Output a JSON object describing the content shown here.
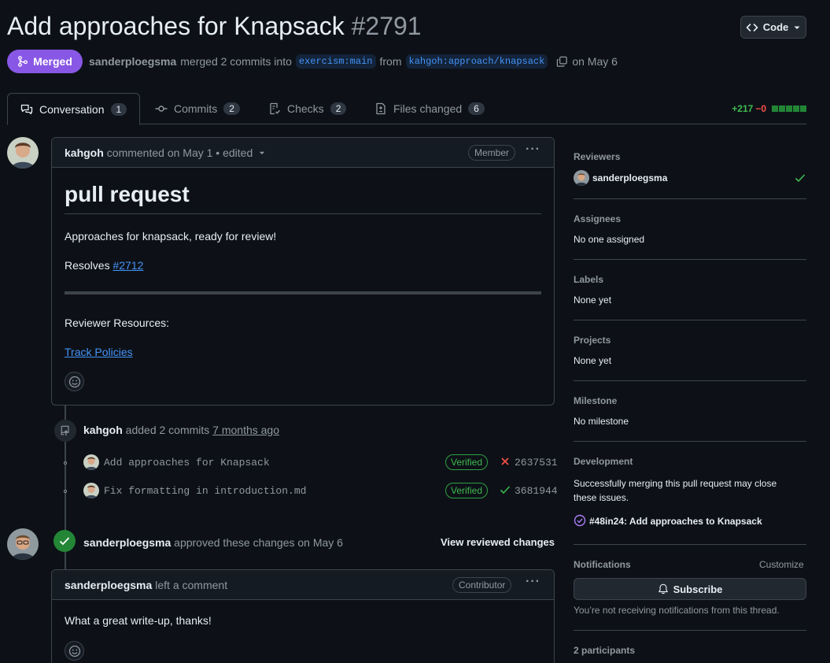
{
  "pr": {
    "title": "Add approaches for Knapsack",
    "number": "#2791",
    "state_label": "Merged",
    "author": "sanderploegsma",
    "merge_text": "merged 2 commits into",
    "base_branch": "exercism:main",
    "from_text": "from",
    "head_branch": "kahgoh:approach/knapsack",
    "date_text": "on May 6",
    "code_button": "Code"
  },
  "tabs": [
    {
      "label": "Conversation",
      "count": "1"
    },
    {
      "label": "Commits",
      "count": "2"
    },
    {
      "label": "Checks",
      "count": "2"
    },
    {
      "label": "Files changed",
      "count": "6"
    }
  ],
  "diffstat": {
    "additions": "+217",
    "deletions": "−0"
  },
  "first_comment": {
    "author": "kahgoh",
    "meta": "commented on May 1 • edited",
    "role": "Member",
    "heading": "pull request",
    "para1": "Approaches for knapsack, ready for review!",
    "resolves_label": "Resolves",
    "resolves_link": "#2712",
    "resources_label": "Reviewer Resources:",
    "resources_link": "Track Policies"
  },
  "commits_event": {
    "author": "kahgoh",
    "text": "added 2 commits",
    "time": "7 months ago"
  },
  "commits": [
    {
      "message": "Add approaches for Knapsack",
      "verified": "Verified",
      "status": "fail",
      "sha": "2637531"
    },
    {
      "message": "Fix formatting in introduction.md",
      "verified": "Verified",
      "status": "pass",
      "sha": "3681944"
    }
  ],
  "review_event": {
    "author": "sanderploegsma",
    "text": "approved these changes on May 6",
    "action": "View reviewed changes"
  },
  "second_comment": {
    "author": "sanderploegsma",
    "meta": "left a comment",
    "role": "Contributor",
    "body": "What a great write-up, thanks!"
  },
  "sidebar": {
    "reviewers_label": "Reviewers",
    "reviewer": "sanderploegsma",
    "assignees_label": "Assignees",
    "assignees_value": "No one assigned",
    "labels_label": "Labels",
    "labels_value": "None yet",
    "projects_label": "Projects",
    "projects_value": "None yet",
    "milestone_label": "Milestone",
    "milestone_value": "No milestone",
    "development_label": "Development",
    "development_text": "Successfully merging this pull request may close these issues.",
    "linked_issue": "#48in24: Add approaches to Knapsack",
    "notifications_label": "Notifications",
    "customize": "Customize",
    "subscribe": "Subscribe",
    "notification_note": "You’re not receiving notifications from this thread.",
    "participants": "2 participants"
  },
  "colors": {
    "merged": "#8957e5",
    "success": "#238636",
    "link": "#4493f8",
    "danger": "#f85149",
    "background": "#0d1117"
  }
}
